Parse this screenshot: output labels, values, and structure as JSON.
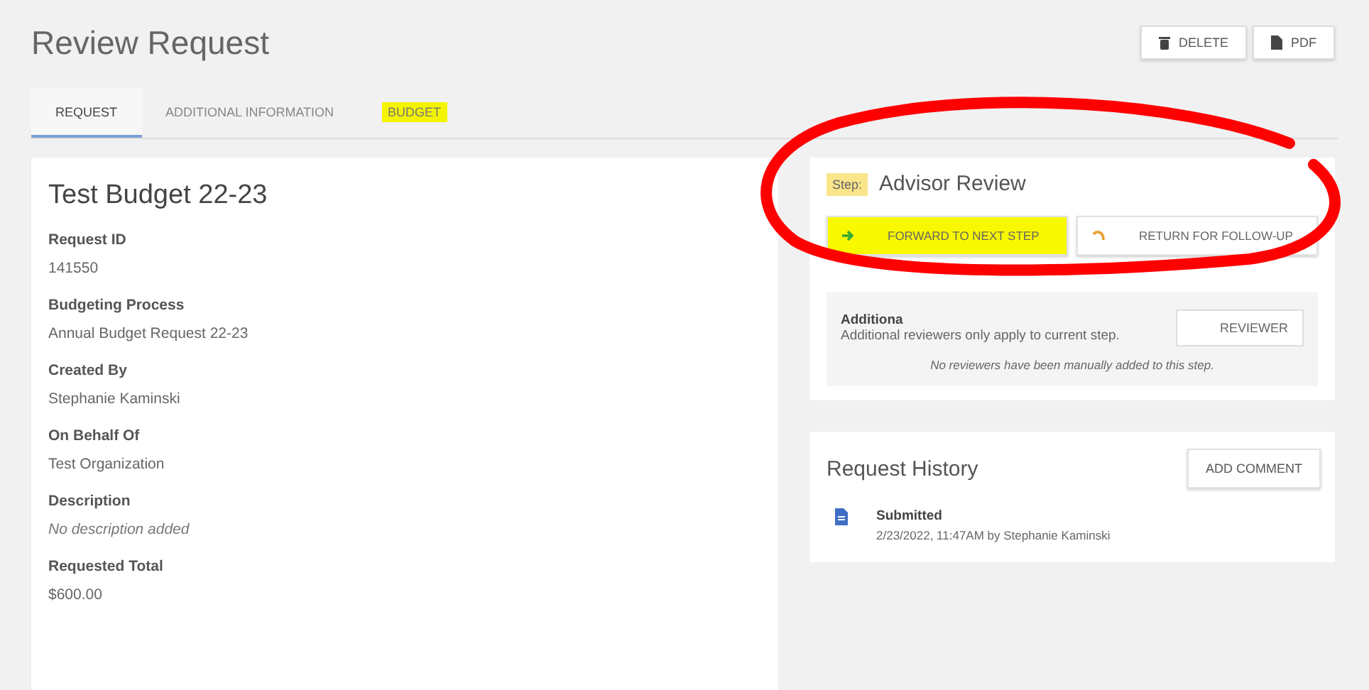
{
  "page": {
    "title": "Review Request"
  },
  "header_buttons": [
    {
      "kind": "delete",
      "label": "DELETE"
    },
    {
      "kind": "pdf",
      "label": "PDF"
    }
  ],
  "tabs": [
    {
      "label": "REQUEST",
      "selected": true,
      "highlighted": false
    },
    {
      "label": "ADDITIONAL INFORMATION",
      "selected": false,
      "highlighted": false
    },
    {
      "label": "BUDGET",
      "selected": false,
      "highlighted": true
    }
  ],
  "request": {
    "title": "Test Budget 22-23",
    "fields": [
      {
        "label": "Request ID",
        "value": "141550",
        "empty": false
      },
      {
        "label": "Budgeting Process",
        "value": "Annual Budget Request 22-23",
        "empty": false
      },
      {
        "label": "Created By",
        "value": "Stephanie Kaminski",
        "empty": false
      },
      {
        "label": "On Behalf Of",
        "value": "Test Organization",
        "empty": false
      },
      {
        "label": "Description",
        "value": "No description added",
        "empty": true
      },
      {
        "label": "Requested Total",
        "value": "$600.00",
        "empty": false
      }
    ]
  },
  "step": {
    "label": "Step:",
    "label_highlighted": true,
    "name": "Advisor Review",
    "actions": [
      {
        "kind": "forward",
        "label": "FORWARD TO NEXT STEP",
        "highlighted": true
      },
      {
        "kind": "return",
        "label": "RETURN FOR FOLLOW-UP",
        "highlighted": false
      }
    ],
    "reviewers": {
      "title": "Additiona",
      "note": "Additional reviewers only apply to current step.",
      "button": "REVIEWER",
      "empty_message": "No reviewers have been manually added to this step."
    }
  },
  "history": {
    "title": "Request History",
    "button": "ADD COMMENT",
    "entries": [
      {
        "title": "Submitted",
        "detail": "2/23/2022, 11:47AM by Stephanie Kaminski"
      }
    ]
  }
}
